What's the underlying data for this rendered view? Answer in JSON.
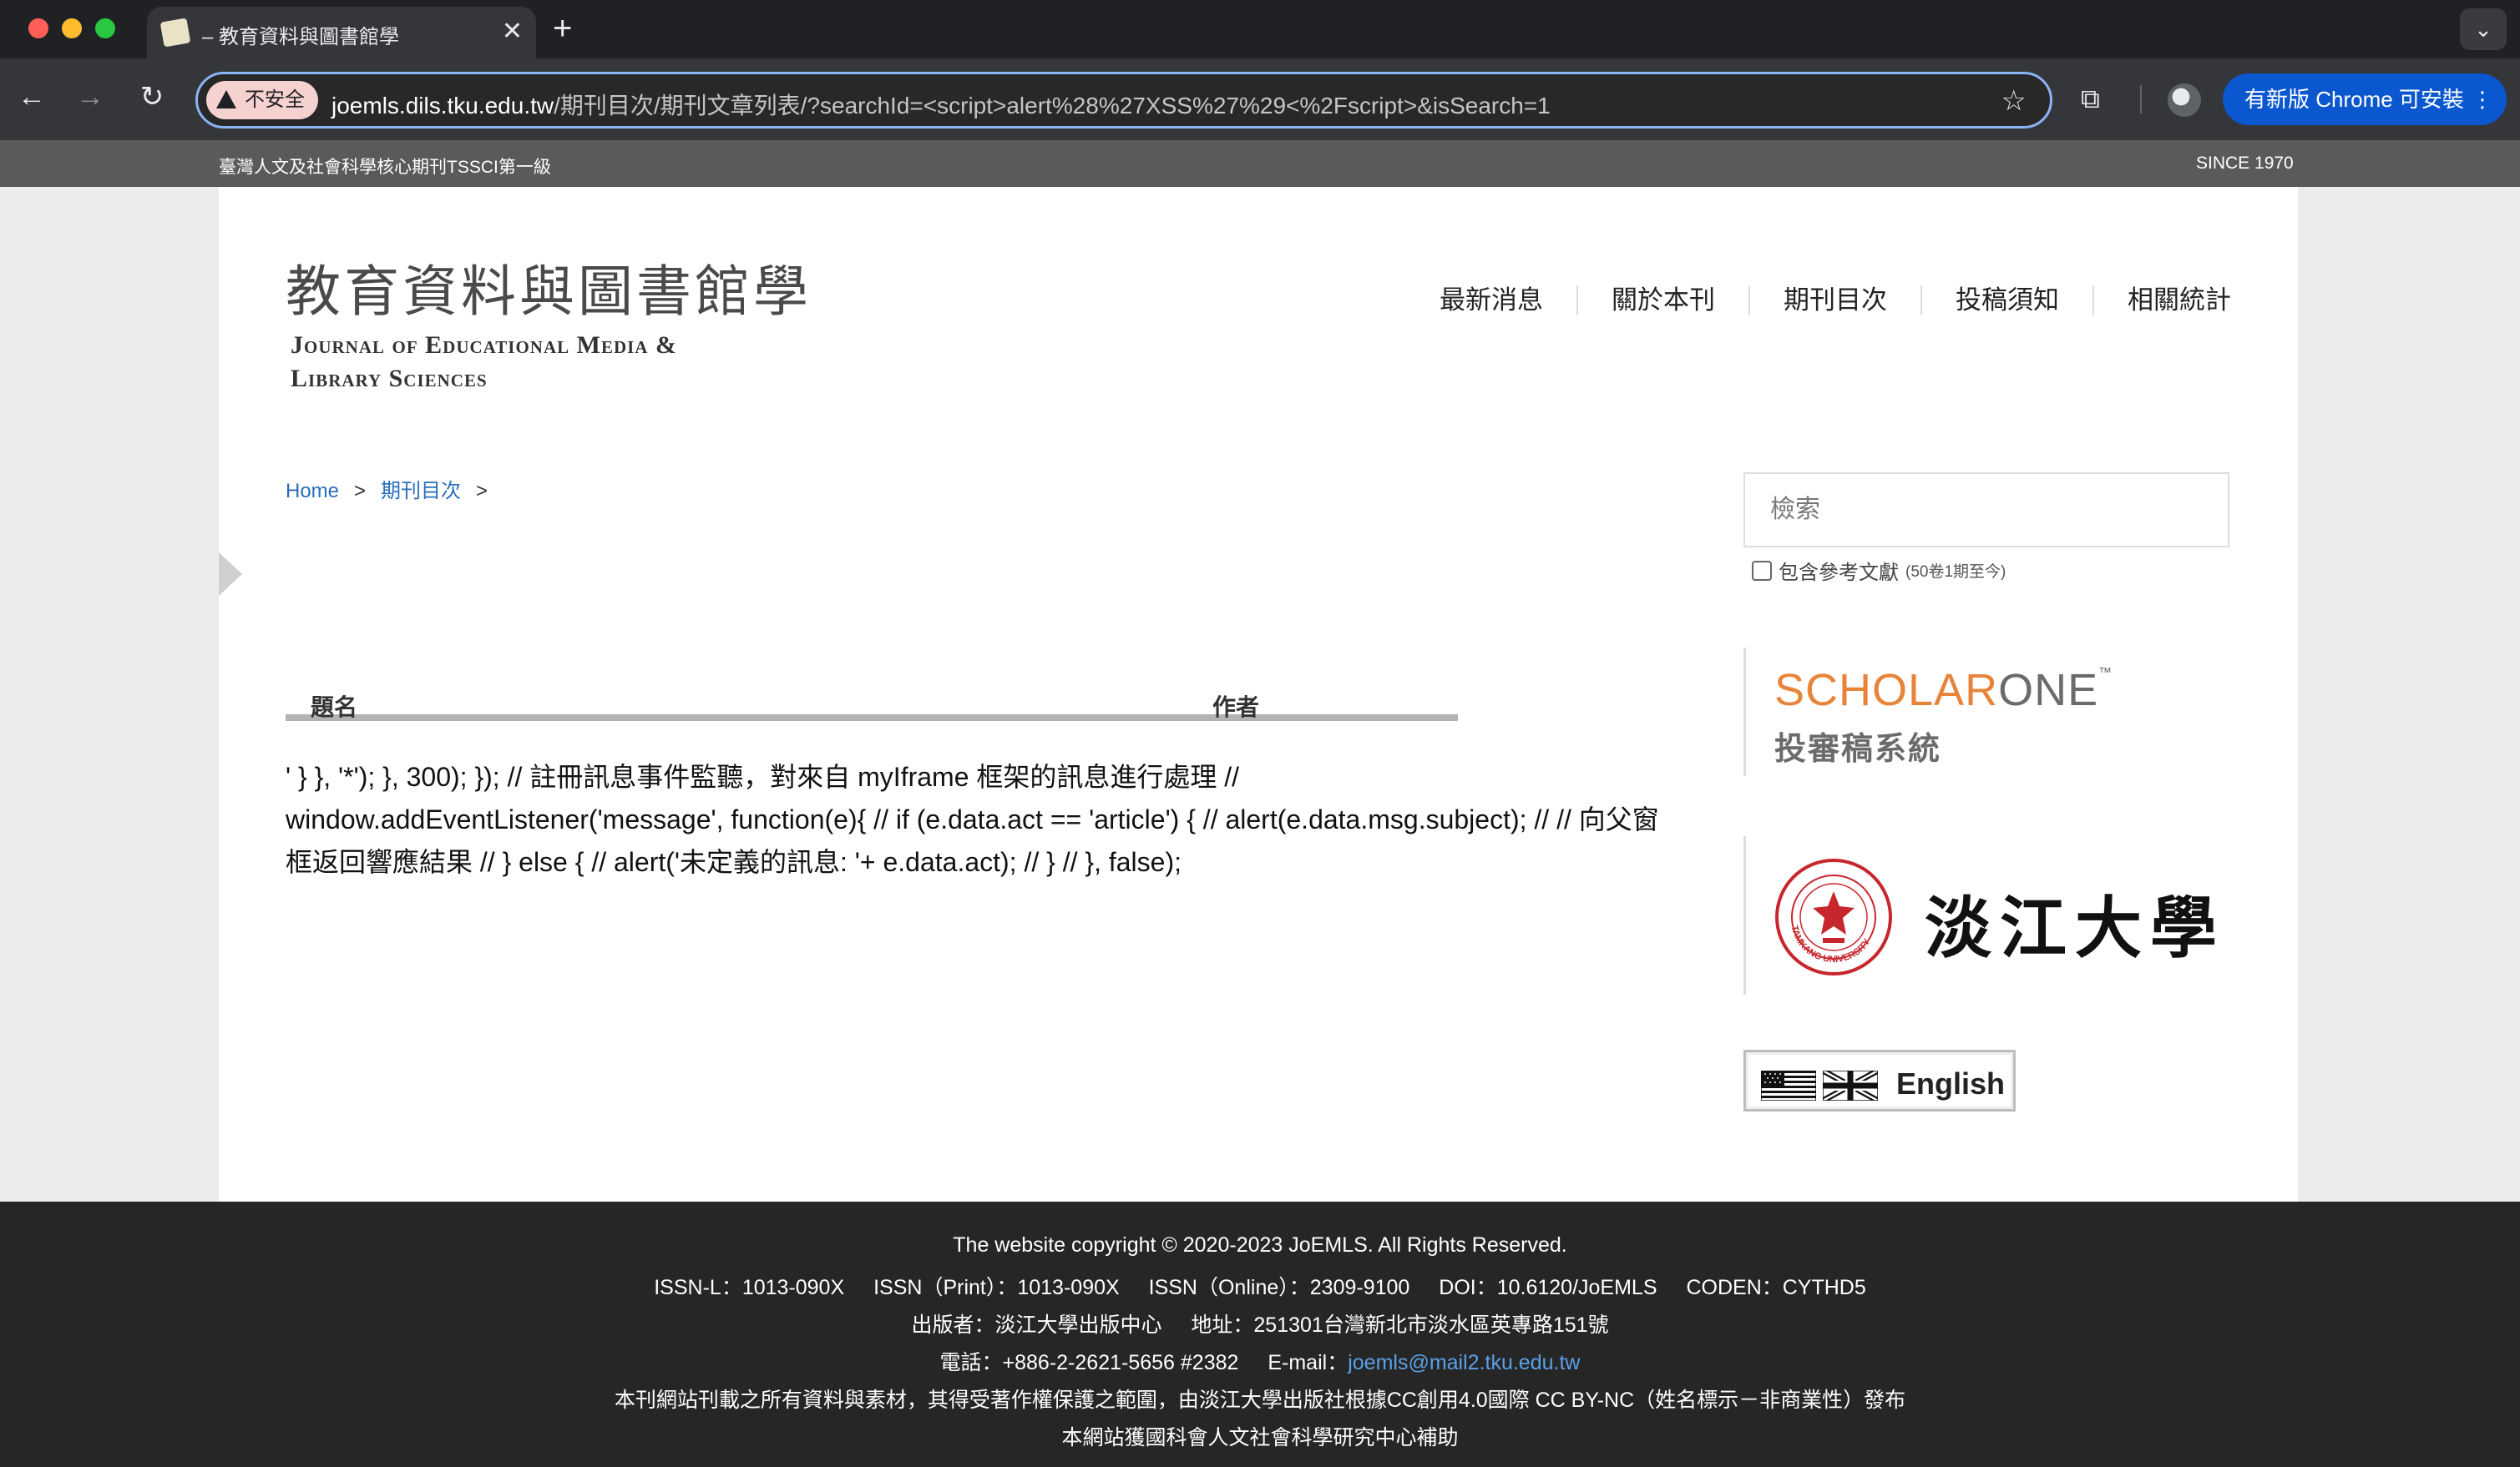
{
  "browser": {
    "tab_title": "– 教育資料與圖書館學",
    "insecure_label": "不安全",
    "url_host": "joemls.dils.tku.edu.tw",
    "url_path": "/期刊目次/期刊文章列表/?searchId=<script>alert%28%27XSS%27%29<%2Fscript>&isSearch=1",
    "update_button": "有新版 Chrome 可安裝",
    "icons": [
      "close-icon",
      "plus-icon",
      "back-arrow-icon",
      "forward-arrow-icon",
      "reload-icon",
      "warning-icon",
      "star-icon",
      "extensions-icon",
      "profile-avatar-icon",
      "more-vert-icon"
    ],
    "colors": {
      "omnibox_focus": "#8ab4f8",
      "update_button": "#0b57d0",
      "insecure_chip": "#f5d2cf"
    }
  },
  "site": {
    "top_left": "臺灣人文及社會科學核心期刊TSSCI第一級",
    "top_right": "SINCE 1970",
    "logo_cn": "教育資料與圖書館學",
    "logo_en_line1": "Journal of Educational Media &",
    "logo_en_line2": "Library Sciences",
    "nav": [
      {
        "label": "最新消息"
      },
      {
        "label": "關於本刊"
      },
      {
        "label": "期刊目次"
      },
      {
        "label": "投稿須知"
      },
      {
        "label": "相關統計"
      }
    ],
    "breadcrumb": {
      "home": "Home",
      "current": "期刊目次",
      "separator": ">"
    },
    "table": {
      "col_title": "題名",
      "col_author": "作者"
    },
    "script_leak_text": "' } }, '*'); }, 300); }); // 註冊訊息事件監聽，對來自 myIframe 框架的訊息進行處理 // window.addEventListener('message', function(e){ // if (e.data.act == 'article') { // alert(e.data.msg.subject); // // 向父窗框返回響應結果 // } else { // alert('未定義的訊息: '+ e.data.act); // } // }, false);",
    "search": {
      "placeholder": "檢索",
      "value": ""
    },
    "include_refs": {
      "label": "包含參考文獻",
      "note": "(50卷1期至今)",
      "checked": false
    },
    "scholarone": {
      "part1": "SCHOLAR",
      "part2": "ONE",
      "tm": "™",
      "subtitle": "投審稿系統"
    },
    "tku": {
      "name_cn": "淡江大學",
      "seal_text": "TAMKANG UNIVERSITY"
    },
    "english_button": "English",
    "colors": {
      "scholarone_orange": "#e8843a",
      "link_blue": "#2a6ebb",
      "footer_bg": "#262626",
      "top_strip": "#5a5a5a"
    }
  },
  "footer": {
    "copyright": "The website copyright © 2020-2023 JoEMLS. All Rights Reserved.",
    "ids": {
      "issn_l": "ISSN-L：1013-090X",
      "issn_print": "ISSN（Print）：1013-090X",
      "issn_online": "ISSN（Online）：2309-9100",
      "doi": "DOI：10.6120/JoEMLS",
      "coden": "CODEN：CYTHD5"
    },
    "publisher": "出版者：淡江大學出版中心",
    "address": "地址：251301台灣新北市淡水區英專路151號",
    "phone": "電話：+886-2-2621-5656 #2382",
    "email_label": "E-mail：",
    "email": "joemls@mail2.tku.edu.tw",
    "license": "本刊網站刊載之所有資料與素材，其得受著作權保護之範圍，由淡江大學出版社根據CC創用4.0國際 CC BY-NC（姓名標示－非商業性）發布",
    "funding": "本網站獲國科會人文社會科學研究中心補助"
  }
}
